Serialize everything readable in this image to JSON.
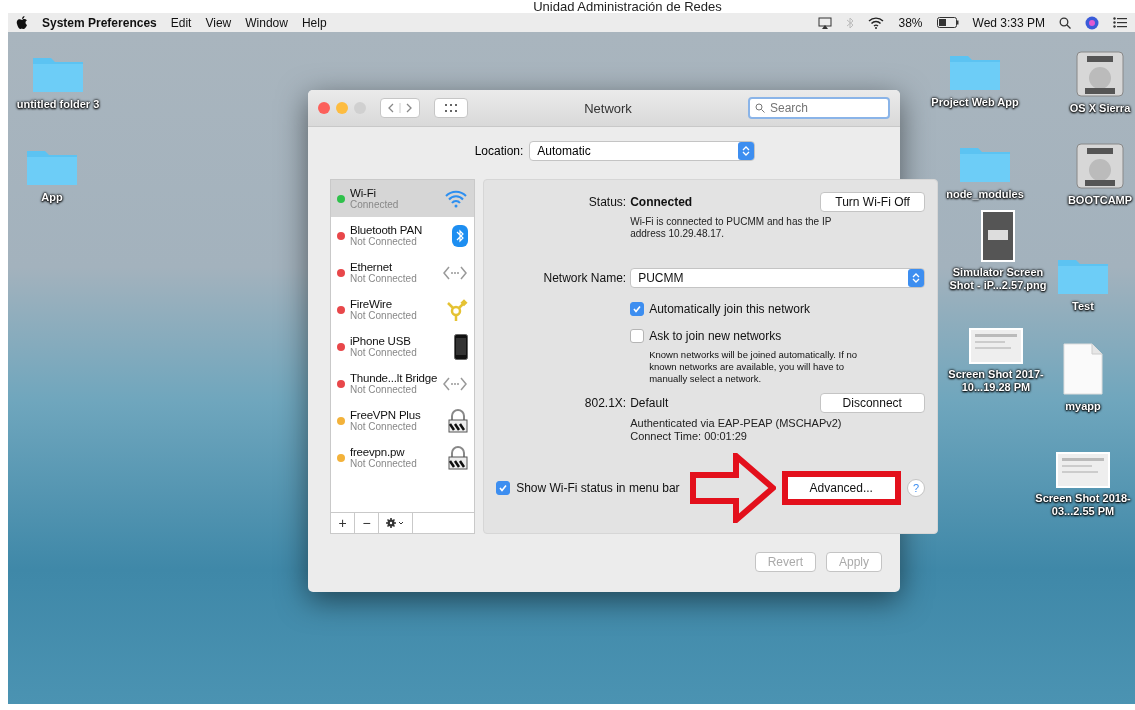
{
  "caption": "Unidad Administración de Redes",
  "menu_bar": {
    "app": "System Preferences",
    "menus": [
      "Edit",
      "View",
      "Window",
      "Help"
    ],
    "battery": "38%",
    "clock": "Wed 3:33 PM"
  },
  "desktop_icons": [
    {
      "label": "untitled folder 3",
      "kind": "folder"
    },
    {
      "label": "App",
      "kind": "folder"
    },
    {
      "label": "Project Web App",
      "kind": "folder"
    },
    {
      "label": "OS X Sierra",
      "kind": "disk"
    },
    {
      "label": "node_modules",
      "kind": "folder"
    },
    {
      "label": "BOOTCAMP",
      "kind": "disk"
    },
    {
      "label": "Simulator Screen Shot - iP...2.57.png",
      "kind": "phone-shot"
    },
    {
      "label": "Test",
      "kind": "folder"
    },
    {
      "label": "Screen Shot 2017-10...19.28 PM",
      "kind": "screenshot"
    },
    {
      "label": "myapp",
      "kind": "document"
    },
    {
      "label": "Screen Shot 2018-03...2.55 PM",
      "kind": "screenshot"
    }
  ],
  "window": {
    "title": "Network",
    "search": {
      "placeholder": "Search"
    },
    "location": {
      "label": "Location:",
      "value": "Automatic"
    },
    "services": [
      {
        "name": "Wi-Fi",
        "status": "Connected",
        "color": "#2fc14b",
        "kind": "wifi",
        "selected": true
      },
      {
        "name": "Bluetooth PAN",
        "status": "Not Connected",
        "color": "#e8474a",
        "kind": "bluetooth",
        "selected": false
      },
      {
        "name": "Ethernet",
        "status": "Not Connected",
        "color": "#e8474a",
        "kind": "ethernet",
        "selected": false
      },
      {
        "name": "FireWire",
        "status": "Not Connected",
        "color": "#e8474a",
        "kind": "firewire",
        "selected": false
      },
      {
        "name": "iPhone USB",
        "status": "Not Connected",
        "color": "#e8474a",
        "kind": "phone",
        "selected": false
      },
      {
        "name": "Thunde...lt Bridge",
        "status": "Not Connected",
        "color": "#e8474a",
        "kind": "ethernet",
        "selected": false
      },
      {
        "name": "FreeVPN Plus",
        "status": "Not Connected",
        "color": "#f3b23a",
        "kind": "vpn",
        "selected": false
      },
      {
        "name": "freevpn.pw",
        "status": "Not Connected",
        "color": "#f3b23a",
        "kind": "vpn",
        "selected": false
      }
    ],
    "list_buttons": [
      "+",
      "−"
    ],
    "status": {
      "label": "Status:",
      "value": "Connected",
      "button": "Turn Wi-Fi Off",
      "note": "Wi-Fi is connected to PUCMM and has the IP address 10.29.48.17."
    },
    "network_name": {
      "label": "Network Name:",
      "value": "PUCMM"
    },
    "options": [
      {
        "label": "Automatically join this network",
        "checked": true
      },
      {
        "label": "Ask to join new networks",
        "checked": false,
        "note": "Known networks will be joined automatically. If no known networks are available, you will have to manually select a network."
      }
    ],
    "auth": {
      "label": "802.1X:",
      "value": "Default",
      "button": "Disconnect",
      "lines": [
        "Authenticated via EAP-PEAP (MSCHAPv2)",
        "Connect Time: 00:01:29"
      ]
    },
    "show_status": {
      "label": "Show Wi-Fi status in menu bar",
      "checked": true
    },
    "advanced_button": "Advanced...",
    "help": "?",
    "buttons": [
      {
        "label": "Revert",
        "disabled": true
      },
      {
        "label": "Apply",
        "disabled": true
      }
    ]
  }
}
